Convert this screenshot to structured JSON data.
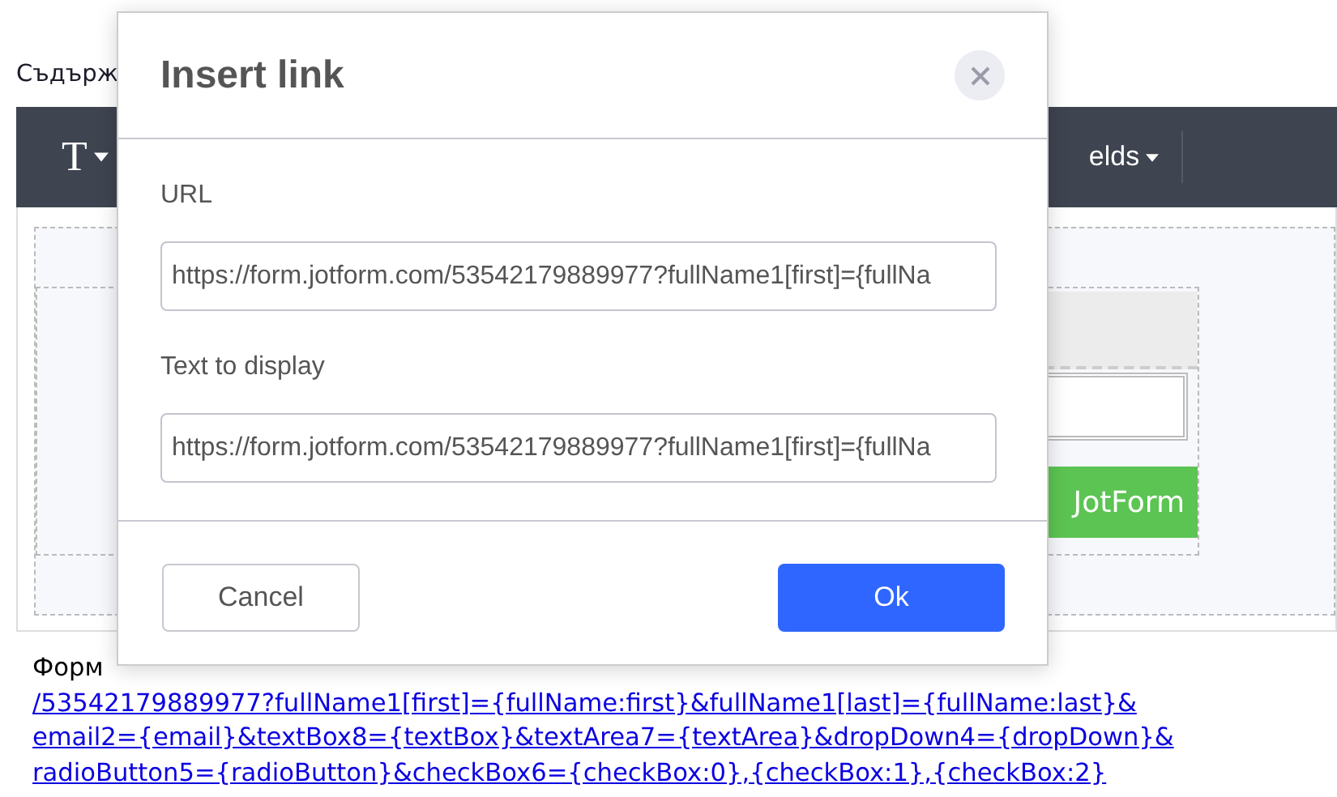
{
  "page": {
    "heading": "Съдърж",
    "toolbar": {
      "text_tool": "T",
      "fields_menu": "elds"
    },
    "form_preview": {
      "submit_label": "JotForm"
    },
    "content": {
      "intro": "Форм",
      "link_lines": [
        "/53542179889977?fullName1[first]={fullName:first}&fullName1[last]={fullName:last}&",
        "email2={email}&textBox8={textBox}&textArea7={textArea}&dropDown4={dropDown}&",
        "radioButton5={radioButton}&checkBox6={checkBox:0},{checkBox:1},{checkBox:2}"
      ]
    }
  },
  "dialog": {
    "title": "Insert link",
    "fields": [
      {
        "label": "URL",
        "value": "https://form.jotform.com/53542179889977?fullName1[first]={fullNa"
      },
      {
        "label": "Text to display",
        "value": "https://form.jotform.com/53542179889977?fullName1[first]={fullNa"
      }
    ],
    "buttons": [
      {
        "label": "Cancel",
        "kind": "secondary"
      },
      {
        "label": "Ok",
        "kind": "primary"
      }
    ]
  }
}
